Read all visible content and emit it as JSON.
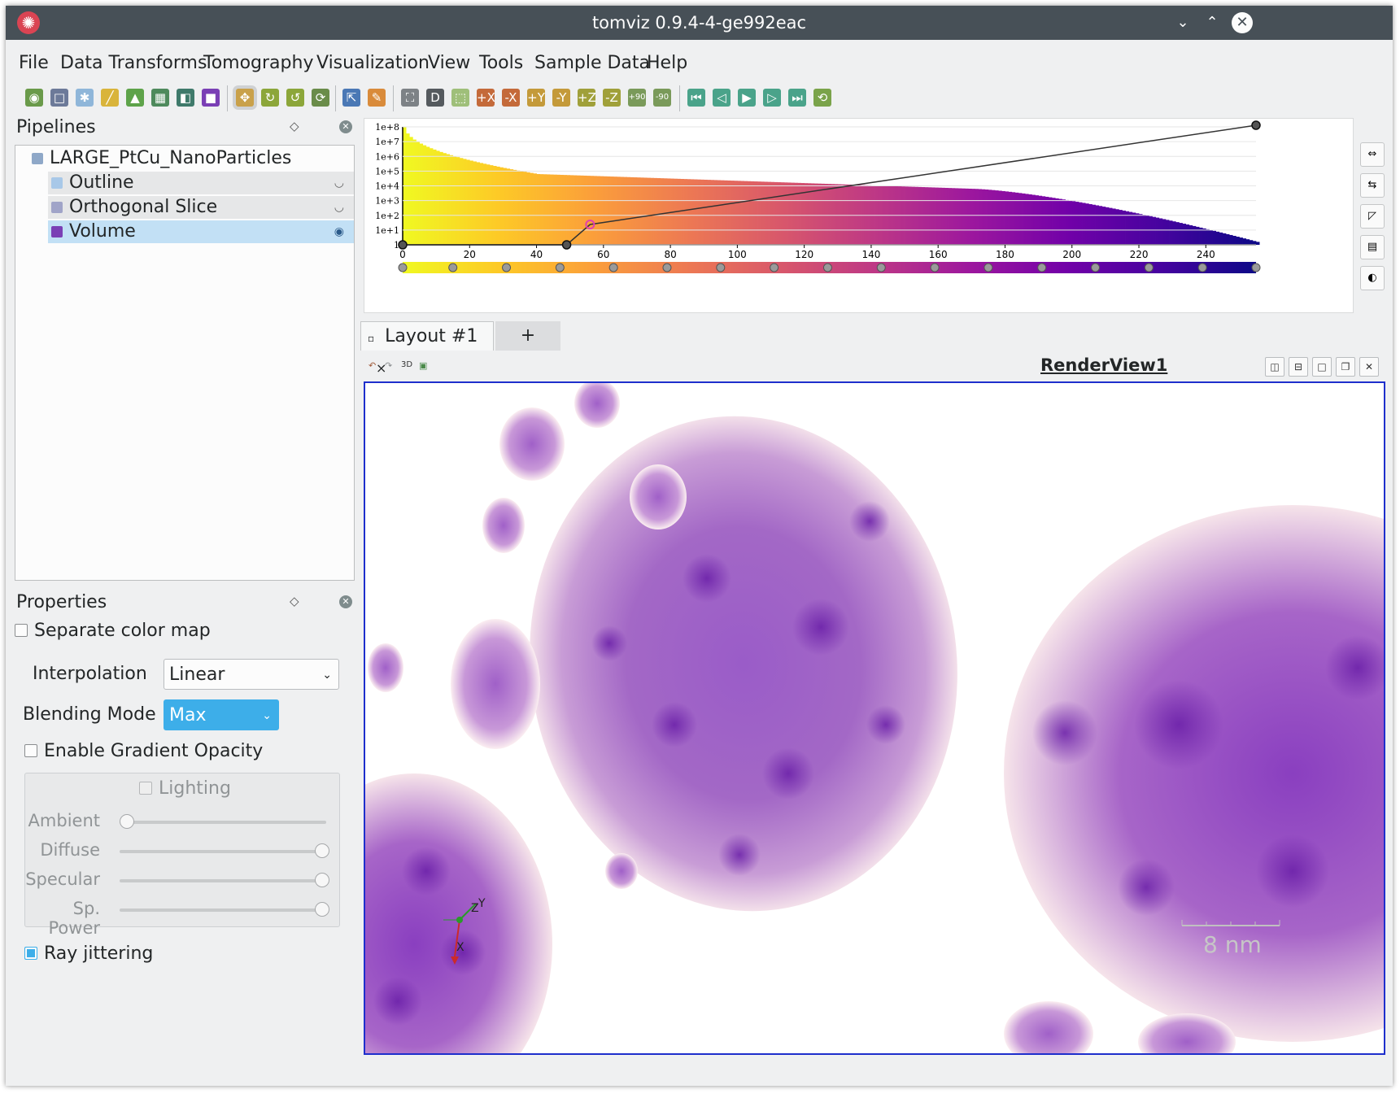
{
  "window": {
    "title": "tomviz 0.9.4-4-ge992eac"
  },
  "menu": [
    "File",
    "Data Transforms",
    "Tomography",
    "Visualization",
    "View",
    "Tools",
    "Sample Data",
    "Help"
  ],
  "toolbar": {
    "icons": [
      "open-data-icon",
      "outline-icon",
      "slice-icon",
      "ruler-icon",
      "threshold-icon",
      "contour-icon",
      "clip-icon",
      "volume-icon",
      "interact-icon",
      "rotate-cw-icon",
      "rotate-ccw-icon",
      "reset-rotate-icon",
      "pick-icon",
      "color-palette-icon",
      "reset-camera-icon",
      "data-axes-icon",
      "select-box-icon",
      "view-plus-x-icon",
      "view-minus-x-icon",
      "view-plus-y-icon",
      "view-minus-y-icon",
      "view-plus-z-icon",
      "view-minus-z-icon",
      "rotate-plus-90-icon",
      "rotate-minus-90-icon",
      "first-frame-icon",
      "previous-frame-icon",
      "play-icon",
      "next-frame-icon",
      "last-frame-icon",
      "loop-icon"
    ],
    "rotate_plus_label": "+90",
    "rotate_minus_label": "-90"
  },
  "pipelines": {
    "title": "Pipelines",
    "data_source": "LARGE_PtCu_NanoParticles",
    "modules": [
      {
        "label": "Outline",
        "visible": false
      },
      {
        "label": "Orthogonal Slice",
        "visible": false
      },
      {
        "label": "Volume",
        "visible": true,
        "selected": true
      }
    ]
  },
  "properties": {
    "title": "Properties",
    "separate_color_map": {
      "label": "Separate color map",
      "checked": false
    },
    "interpolation": {
      "label": "Interpolation",
      "value": "Linear"
    },
    "blending_mode": {
      "label": "Blending Mode",
      "value": "Max"
    },
    "gradient_opacity": {
      "label": "Enable Gradient Opacity",
      "checked": false
    },
    "lighting": {
      "label": "Lighting",
      "checked": false,
      "sliders": [
        {
          "label": "Ambient",
          "value": 0.0
        },
        {
          "label": "Diffuse",
          "value": 1.0
        },
        {
          "label": "Specular",
          "value": 1.0
        },
        {
          "label": "Sp. Power",
          "value": 1.0
        }
      ]
    },
    "ray_jittering": {
      "label": "Ray jittering",
      "checked": true
    }
  },
  "histogram": {
    "y_ticks": [
      "1e+8",
      "1e+7",
      "1e+6",
      "1e+5",
      "1e+4",
      "1e+3",
      "1e+2",
      "1e+1",
      "1"
    ],
    "x_ticks": [
      "0",
      "20",
      "40",
      "60",
      "80",
      "100",
      "120",
      "140",
      "160",
      "180",
      "200",
      "220",
      "240"
    ],
    "x_range": [
      0,
      255
    ],
    "opacity_points": [
      {
        "x": 0,
        "opacity": 0.0
      },
      {
        "x": 49,
        "opacity": 0.0
      },
      {
        "x": 56,
        "opacity": 0.17
      },
      {
        "x": 255,
        "opacity": 1.0
      }
    ],
    "colormap_points": [
      0,
      15,
      31,
      47,
      63,
      79,
      95,
      111,
      127,
      143,
      159,
      175,
      191,
      207,
      223,
      239,
      255
    ],
    "colormap": [
      "#f0f921",
      "#fdca26",
      "#fb9f3a",
      "#ed7953",
      "#d8576b",
      "#bd3786",
      "#9c179e",
      "#7201a8",
      "#46039f",
      "#0d0887"
    ]
  },
  "layout": {
    "tab_label": "Layout #1",
    "tab_close": "×",
    "add_tab": "+",
    "view_buttons": [
      "camera-undo-icon",
      "camera-redo-icon",
      "3D",
      "capture-icon"
    ],
    "render_view_name": "RenderView1",
    "view_controls": [
      "split-horizontal-icon",
      "split-vertical-icon",
      "maximize-icon",
      "restore-icon",
      "close-icon"
    ]
  },
  "render": {
    "scale_label": "8 nm",
    "axes": [
      "X",
      "Y",
      "Z"
    ]
  }
}
